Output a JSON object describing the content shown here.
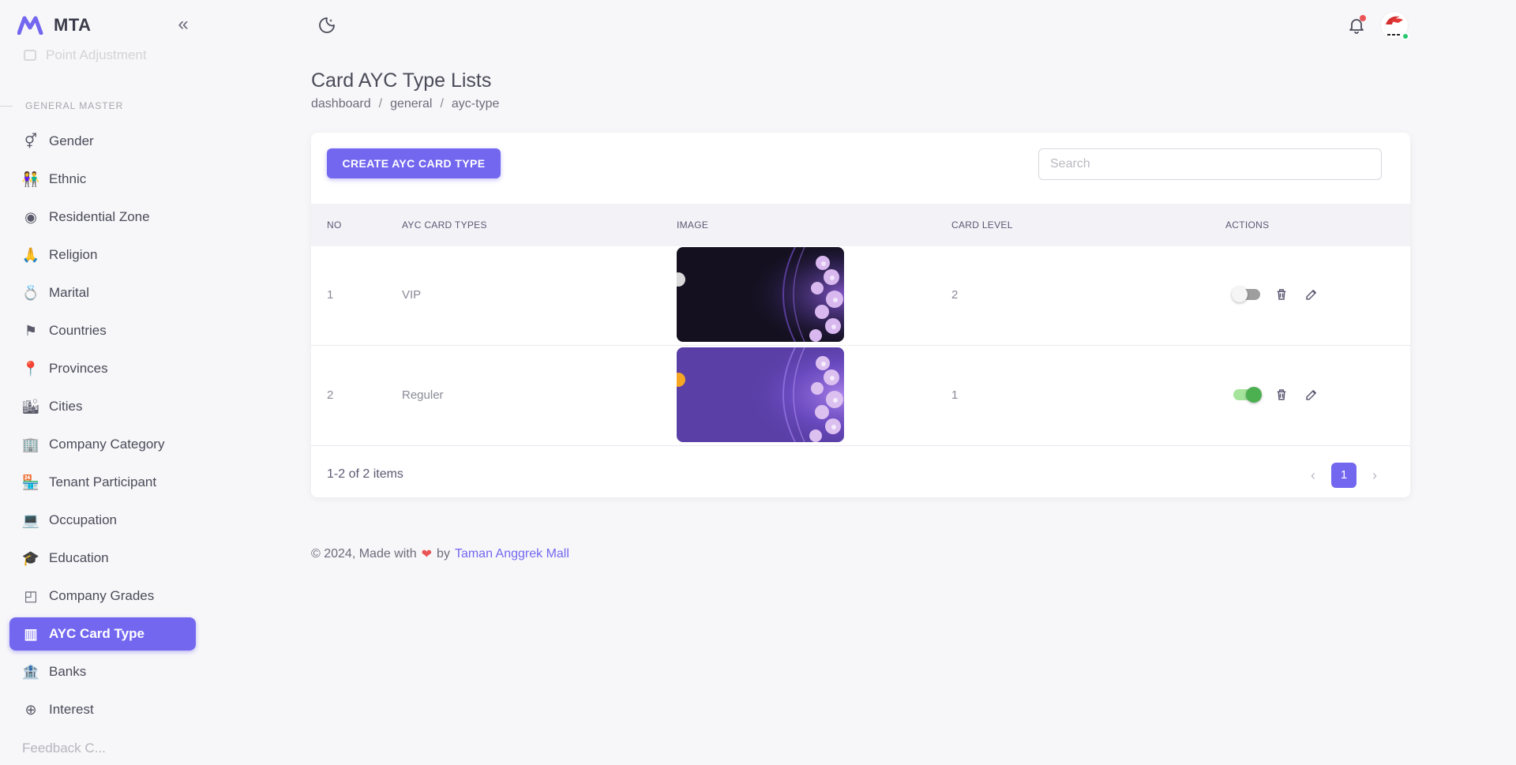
{
  "app": {
    "name": "MTA"
  },
  "sidebar": {
    "ghost_item": "Point Adjustment",
    "section_label": "GENERAL MASTER",
    "items": [
      {
        "label": "Gender",
        "icon": "gender-icon"
      },
      {
        "label": "Ethnic",
        "icon": "people-icon"
      },
      {
        "label": "Residential Zone",
        "icon": "location-circle-icon"
      },
      {
        "label": "Religion",
        "icon": "praying-hands-icon"
      },
      {
        "label": "Marital",
        "icon": "ring-icon"
      },
      {
        "label": "Countries",
        "icon": "flag-icon"
      },
      {
        "label": "Provinces",
        "icon": "map-pin-icon"
      },
      {
        "label": "Cities",
        "icon": "city-icon"
      },
      {
        "label": "Company Category",
        "icon": "office-building-icon"
      },
      {
        "label": "Tenant Participant",
        "icon": "store-icon"
      },
      {
        "label": "Occupation",
        "icon": "laptop-icon"
      },
      {
        "label": "Education",
        "icon": "graduation-cap-icon"
      },
      {
        "label": "Company Grades",
        "icon": "badge-square-icon"
      },
      {
        "label": "AYC Card Type",
        "icon": "cards-icon"
      },
      {
        "label": "Banks",
        "icon": "bank-icon"
      },
      {
        "label": "Interest",
        "icon": "basketball-icon"
      }
    ],
    "active_index": 13,
    "peek_label": "Feedback C..."
  },
  "page": {
    "title": "Card AYC Type Lists",
    "breadcrumb": [
      "dashboard",
      "general",
      "ayc-type"
    ]
  },
  "toolbar": {
    "create_label": "CREATE AYC CARD TYPE",
    "search_placeholder": "Search"
  },
  "table": {
    "columns": [
      "NO",
      "AYC CARD TYPES",
      "IMAGE",
      "CARD LEVEL",
      "ACTIONS"
    ],
    "rows": [
      {
        "no": "1",
        "type": "VIP",
        "card_level": "2",
        "active": false,
        "image_theme": "dark"
      },
      {
        "no": "2",
        "type": "Reguler",
        "card_level": "1",
        "active": true,
        "image_theme": "purple"
      }
    ]
  },
  "pagination": {
    "info": "1-2 of 2 items",
    "current_page": "1"
  },
  "footer": {
    "text_prefix": "© 2024, Made with",
    "text_by": "by",
    "link": "Taman Anggrek Mall"
  },
  "colors": {
    "primary": "#7367f0",
    "vip_card_bg": "#14101f",
    "reguler_card_bg": "#5a3fa6",
    "toggle_on": "#4caf50",
    "danger": "#ea5455"
  }
}
